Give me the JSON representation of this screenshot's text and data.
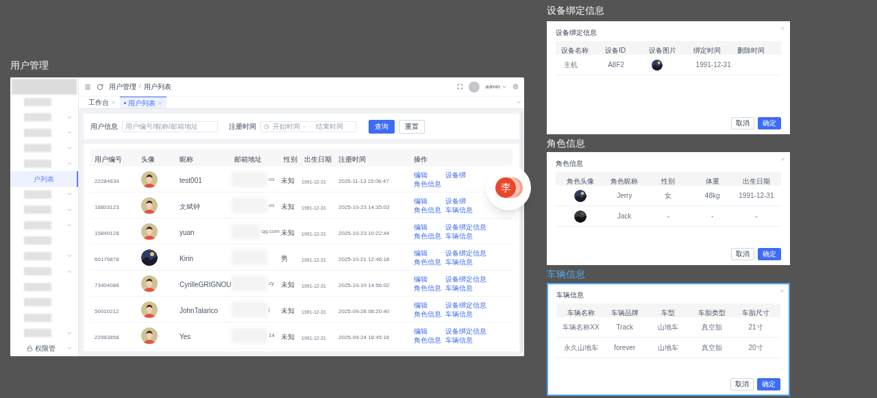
{
  "page_title": "用户管理",
  "sidebar": {
    "items": [
      {
        "kind": "page",
        "selected": false
      },
      {
        "kind": "group",
        "expanded": false
      },
      {
        "kind": "group",
        "expanded": false
      },
      {
        "kind": "group",
        "expanded": false
      },
      {
        "kind": "group",
        "expanded": true
      },
      {
        "kind": "page",
        "label": "户列表",
        "selected": true
      },
      {
        "kind": "group",
        "expanded": false
      },
      {
        "kind": "group",
        "expanded": false
      },
      {
        "kind": "group",
        "expanded": true
      },
      {
        "kind": "page",
        "selected": false
      },
      {
        "kind": "group",
        "expanded": false
      },
      {
        "kind": "group",
        "expanded": true
      },
      {
        "kind": "page",
        "selected": false
      },
      {
        "kind": "page",
        "selected": false
      },
      {
        "kind": "page",
        "selected": false
      },
      {
        "kind": "group",
        "expanded": false
      },
      {
        "kind": "group",
        "expanded": false,
        "label": "权限管"
      }
    ]
  },
  "header": {
    "breadcrumb": [
      "用户管理",
      "用户列表"
    ],
    "separator": "/",
    "user": "admin"
  },
  "tabs": [
    {
      "label": "工作台",
      "selected": false
    },
    {
      "label": "用户列表",
      "selected": true
    }
  ],
  "search": {
    "user_label": "用户信息",
    "user_placeholder": "用户编号/昵称/邮箱地址",
    "date_label": "注册时间",
    "start_placeholder": "开始时间",
    "range_separator": "-",
    "end_placeholder": "结束时间",
    "buttons": [
      {
        "label": "查询",
        "kind": "primary"
      },
      {
        "label": "重置",
        "kind": "default"
      }
    ]
  },
  "table": {
    "columns": [
      "用户编号",
      "头像",
      "昵称",
      "邮箱地址",
      "性别",
      "出生日期",
      "注册时间",
      "操作"
    ],
    "rows": [
      {
        "id": "22284634",
        "avatar": {
          "kind": "cartoon"
        },
        "nickname": "test001",
        "email": "co",
        "gender": "未知",
        "birth": "1991-12-31",
        "registered": "2025-11-13 15:06:47",
        "actions": [
          "编辑",
          "设备绑",
          "角色信息"
        ]
      },
      {
        "id": "18803123",
        "avatar": {
          "kind": "cartoon"
        },
        "nickname": "文斌钟",
        "email": "co",
        "gender": "未知",
        "birth": "1991-12-31",
        "registered": "2025-10-23 14:35:03",
        "actions": [
          "编辑",
          "设备绑",
          "角色信息",
          "车辆信息"
        ]
      },
      {
        "id": "15849128",
        "avatar": {
          "kind": "cartoon"
        },
        "nickname": "yuan",
        "email": "qq.com",
        "gender": "未知",
        "birth": "1991-12-31",
        "registered": "2025-10-23 10:22:44",
        "actions": [
          "编辑",
          "设备绑定信息",
          "角色信息",
          "车辆信息"
        ]
      },
      {
        "id": "60179878",
        "avatar": {
          "kind": "picture"
        },
        "nickname": "Kirin",
        "gender": "男",
        "birth": "1991-12-31",
        "registered": "2025-10-21 12:46:18",
        "actions": [
          "编辑",
          "设备绑定信息",
          "角色信息",
          "车辆信息"
        ]
      },
      {
        "id": "73404088",
        "avatar": {
          "kind": "cartoon"
        },
        "nickname": "CyrilleGRIGNOU",
        "email": "cy",
        "gender": "未知",
        "birth": "1991-12-31",
        "registered": "2025-10-10 14:56:02",
        "actions": [
          "编辑",
          "设备绑定信息",
          "角色信息",
          "车辆信息"
        ]
      },
      {
        "id": "50010212",
        "avatar": {
          "kind": "cartoon"
        },
        "nickname": "JohnTalarico",
        "email": "j",
        "gender": "未知",
        "birth": "1991-12-31",
        "registered": "2025-09-28 08:20:40",
        "actions": [
          "编辑",
          "设备绑定信息",
          "角色信息",
          "车辆信息"
        ]
      },
      {
        "id": "22983858",
        "avatar": {
          "kind": "cartoon"
        },
        "nickname": "Yes",
        "email": "14",
        "gender": "未知",
        "birth": "1991-12-31",
        "registered": "2025-09-24 18:45:16",
        "actions": [
          "编辑",
          "设备绑定信息",
          "角色信息",
          "车辆信息"
        ]
      }
    ]
  },
  "floating_badge": {
    "text": "李"
  },
  "sections": [
    {
      "title": "设备绑定信息",
      "selected": false,
      "dialog": {
        "title": "设备绑定信息",
        "columns": [
          "设备名称",
          "设备ID",
          "设备图片",
          "绑定时间",
          "删除时间"
        ],
        "kind": "left-aligned",
        "rows": [
          [
            {
              "kind": "text",
              "text": "主机"
            },
            {
              "kind": "text",
              "text": "A8F2"
            },
            {
              "kind": "picture"
            },
            {
              "kind": "text",
              "text": "1991-12-31"
            }
          ]
        ],
        "buttons": [
          {
            "label": "取消",
            "kind": "default"
          },
          {
            "label": "确定",
            "kind": "primary"
          }
        ]
      }
    },
    {
      "title": "角色信息",
      "selected": false,
      "dialog": {
        "title": "角色信息",
        "columns": [
          "角色头像",
          "角色昵称",
          "性别",
          "体重",
          "出生日期"
        ],
        "kind": "centered",
        "rows": [
          [
            {
              "kind": "picture"
            },
            {
              "kind": "text",
              "text": "Jerry"
            },
            {
              "kind": "text",
              "text": "女"
            },
            {
              "kind": "text",
              "text": "48kg"
            },
            {
              "kind": "text",
              "text": "1991-12-31"
            }
          ],
          [
            {
              "kind": "picture"
            },
            {
              "kind": "text",
              "text": "Jack"
            },
            {
              "kind": "text",
              "text": "-"
            },
            {
              "kind": "text",
              "text": "-"
            },
            {
              "kind": "text",
              "text": "-"
            }
          ]
        ],
        "buttons": [
          {
            "label": "取消",
            "kind": "default"
          },
          {
            "label": "确定",
            "kind": "primary"
          }
        ]
      }
    },
    {
      "title": "车辆信息",
      "selected": true,
      "dialog": {
        "title": "车辆信息",
        "columns": [
          "车辆名称",
          "车辆品牌",
          "车型",
          "车胎类型",
          "车胎尺寸"
        ],
        "kind": "centered",
        "rows": [
          [
            {
              "kind": "text",
              "text": "车辆名称XX"
            },
            {
              "kind": "text",
              "text": "Track"
            },
            {
              "kind": "text",
              "text": "山地车"
            },
            {
              "kind": "text",
              "text": "真空胎"
            },
            {
              "kind": "text",
              "text": "21寸"
            }
          ],
          [
            {
              "kind": "text",
              "text": "永久山地车"
            },
            {
              "kind": "text",
              "text": "forever"
            },
            {
              "kind": "text",
              "text": "山地车"
            },
            {
              "kind": "text",
              "text": "真空胎"
            },
            {
              "kind": "text",
              "text": "20寸"
            }
          ]
        ],
        "buttons": [
          {
            "label": "取消",
            "kind": "default"
          },
          {
            "label": "确定",
            "kind": "primary"
          }
        ]
      }
    }
  ]
}
